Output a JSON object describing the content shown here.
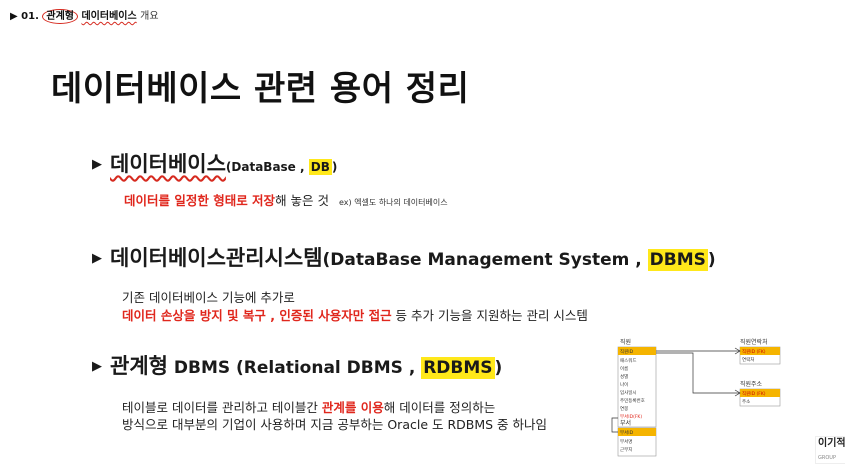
{
  "breadcrumb": {
    "prefix": "▶ 01.",
    "circled": "관계형",
    "wavy": "데이터베이스",
    "suffix": "개요"
  },
  "title": "데이터베이스 관련 용어 정리",
  "sections": [
    {
      "bullet": "▶",
      "term": "데이터베이스",
      "paren_prefix": "(DataBase , ",
      "abbr": "DB",
      "paren_suffix": ")",
      "desc_red": "데이터를 일정한 형태로 저장",
      "desc_rest": "해 놓은 것",
      "note": "ex) 엑셀도 하나의 데이터베이스"
    },
    {
      "bullet": "▶",
      "term": "데이터베이스관리시스템",
      "paren_prefix": "(DataBase Management System , ",
      "abbr": "DBMS",
      "paren_suffix": ")",
      "line1": "기존 데이터베이스 기능에 추가로",
      "line2_red": "데이터 손상을 방지 및 복구 , 인증된 사용자만 접근",
      "line2_rest": " 등 추가 기능을 지원하는 관리 시스템"
    },
    {
      "bullet": "▶",
      "term": "관계형",
      "paren_prefix": " DBMS (Relational DBMS , ",
      "abbr": "RDBMS",
      "paren_suffix": ")",
      "line1_a": "테이블로 데이터를 관리하고 테이블간 ",
      "line1_red": "관계를 이용",
      "line1_b": "해 데이터를 정의하는",
      "line2": "방식으로 대부분의 기업이 사용하며 지금 공부하는 Oracle 도 RDBMS 중 하나임"
    }
  ],
  "erd": {
    "employee": {
      "name": "직원",
      "fields": [
        "직원ID",
        "패스워드",
        "이름",
        "성별",
        "나이",
        "입사일시",
        "주민등록번호",
        "연봉",
        "부서ID(FK)"
      ]
    },
    "contact": {
      "name": "직원연락처",
      "fields": [
        "직원ID (FK)",
        "연락처"
      ]
    },
    "address": {
      "name": "직원주소",
      "fields": [
        "직원ID (FK)",
        "주소"
      ]
    },
    "dept": {
      "name": "부서",
      "fields": [
        "부서ID",
        "부서명",
        "근무지"
      ]
    }
  },
  "logo": {
    "text": "이기적",
    "sub": "GROUP STUDY"
  },
  "colors": {
    "accent_red": "#e0271d",
    "highlight": "#ffe81a",
    "erd_key": "#f5b400"
  }
}
